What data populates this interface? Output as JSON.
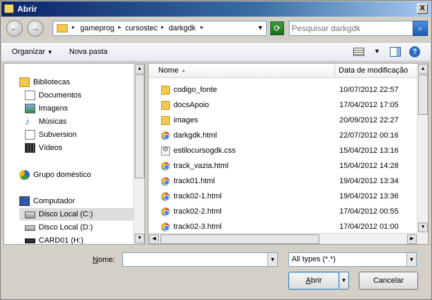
{
  "window": {
    "title": "Abrir",
    "close_glyph": "X"
  },
  "nav": {
    "back_glyph": "←",
    "forward_glyph": "→",
    "breadcrumb": [
      "gameprog",
      "cursostec",
      "darkgdk"
    ],
    "search_placeholder": "Pesquisar darkgdk",
    "refresh_icon": "refresh-icon",
    "search_icon": "magnifier-icon"
  },
  "toolbar": {
    "organize": "Organizar",
    "new_folder": "Nova pasta",
    "help_glyph": "?"
  },
  "sidebar": {
    "items": [
      {
        "label": "Bibliotecas",
        "icon": "libraries-icon"
      },
      {
        "label": "Documentos",
        "icon": "documents-icon"
      },
      {
        "label": "Imagens",
        "icon": "pictures-icon"
      },
      {
        "label": "Músicas",
        "icon": "music-icon"
      },
      {
        "label": "Subversion",
        "icon": "subversion-icon"
      },
      {
        "label": "Vídeos",
        "icon": "videos-icon"
      },
      {
        "label": "Grupo doméstico",
        "icon": "homegroup-icon"
      },
      {
        "label": "Computador",
        "icon": "computer-icon"
      },
      {
        "label": "Disco Local (C:)",
        "icon": "drive-icon",
        "selected": true
      },
      {
        "label": "Disco Local (D:)",
        "icon": "drive-icon"
      },
      {
        "label": "CARD01 (H:)",
        "icon": "removable-drive-icon"
      }
    ]
  },
  "files": {
    "columns": {
      "name": "Nome",
      "date": "Data de modificação"
    },
    "rows": [
      {
        "name": "codigo_fonte",
        "date": "10/07/2012 22:57",
        "type": "folder"
      },
      {
        "name": "docsApoio",
        "date": "17/04/2012 17:05",
        "type": "folder"
      },
      {
        "name": "images",
        "date": "20/09/2012 22:27",
        "type": "folder"
      },
      {
        "name": "darkgdk.html",
        "date": "22/07/2012 00:16",
        "type": "html"
      },
      {
        "name": "estilocursogdk.css",
        "date": "15/04/2012 13:16",
        "type": "css"
      },
      {
        "name": "track_vazia.html",
        "date": "15/04/2012 14:28",
        "type": "html"
      },
      {
        "name": "track01.html",
        "date": "19/04/2012 13:34",
        "type": "html"
      },
      {
        "name": "track02-1.html",
        "date": "19/04/2012 13:36",
        "type": "html"
      },
      {
        "name": "track02-2.html",
        "date": "17/04/2012 00:55",
        "type": "html"
      },
      {
        "name": "track02-3.html",
        "date": "17/04/2012 01:00",
        "type": "html"
      }
    ]
  },
  "footer": {
    "name_label_prefix": "N",
    "name_label_rest": "ome:",
    "name_value": "",
    "file_type": "All types (*.*)",
    "open_u": "A",
    "open_rest": "brir",
    "cancel": "Cancelar"
  }
}
